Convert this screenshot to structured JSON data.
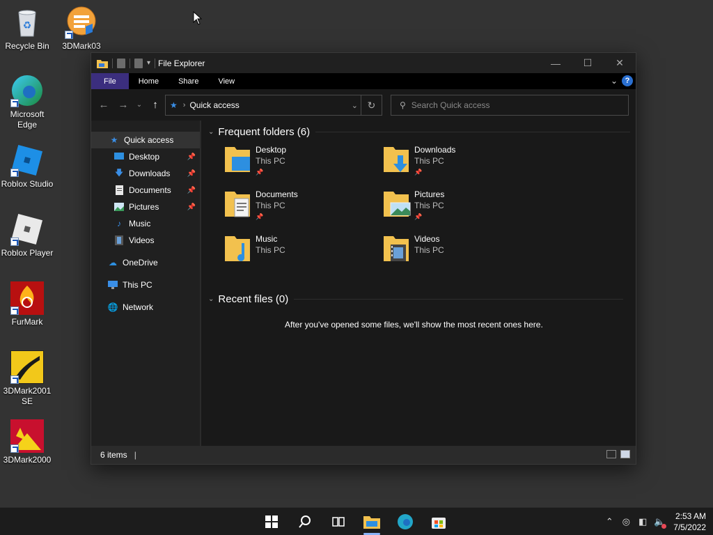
{
  "desktop": {
    "icons": [
      {
        "label": "Recycle Bin",
        "icon": "recycle-bin-icon"
      },
      {
        "label": "3DMark03",
        "icon": "3dmark03-icon"
      },
      {
        "label": "Microsoft Edge",
        "icon": "edge-icon"
      },
      {
        "label": "Roblox Studio",
        "icon": "roblox-studio-icon"
      },
      {
        "label": "Roblox Player",
        "icon": "roblox-player-icon"
      },
      {
        "label": "FurMark",
        "icon": "furmark-icon"
      },
      {
        "label": "3DMark2001 SE",
        "icon": "3dmark2001-icon"
      },
      {
        "label": "3DMark2000",
        "icon": "3dmark2000-icon"
      }
    ]
  },
  "window": {
    "title": "File Explorer",
    "ribbon_tabs": [
      "File",
      "Home",
      "Share",
      "View"
    ],
    "address": {
      "location": "Quick access"
    },
    "search": {
      "placeholder": "Search Quick access"
    },
    "nav": [
      {
        "label": "Quick access",
        "pinned": false
      },
      {
        "label": "Desktop",
        "pinned": true
      },
      {
        "label": "Downloads",
        "pinned": true
      },
      {
        "label": "Documents",
        "pinned": true
      },
      {
        "label": "Pictures",
        "pinned": true
      },
      {
        "label": "Music",
        "pinned": false
      },
      {
        "label": "Videos",
        "pinned": false
      },
      {
        "label": "OneDrive",
        "pinned": false
      },
      {
        "label": "This PC",
        "pinned": false
      },
      {
        "label": "Network",
        "pinned": false
      }
    ],
    "frequent": {
      "header": "Frequent folders (6)",
      "folders": [
        {
          "name": "Desktop",
          "location": "This PC",
          "pinned": true
        },
        {
          "name": "Downloads",
          "location": "This PC",
          "pinned": true
        },
        {
          "name": "Documents",
          "location": "This PC",
          "pinned": true
        },
        {
          "name": "Pictures",
          "location": "This PC",
          "pinned": true
        },
        {
          "name": "Music",
          "location": "This PC",
          "pinned": false
        },
        {
          "name": "Videos",
          "location": "This PC",
          "pinned": false
        }
      ]
    },
    "recent": {
      "header": "Recent files (0)",
      "empty_message": "After you've opened some files, we'll show the most recent ones here."
    },
    "status": {
      "items": "6 items"
    }
  },
  "taskbar": {
    "apps": [
      "start-icon",
      "search-icon",
      "task-view-icon",
      "file-explorer-icon",
      "edge-icon",
      "store-icon"
    ],
    "active_app": "file-explorer-icon",
    "time": "2:53 AM",
    "date": "7/5/2022"
  },
  "colors": {
    "accent": "#3b2e7e",
    "background": "#333333",
    "window": "#191919"
  }
}
